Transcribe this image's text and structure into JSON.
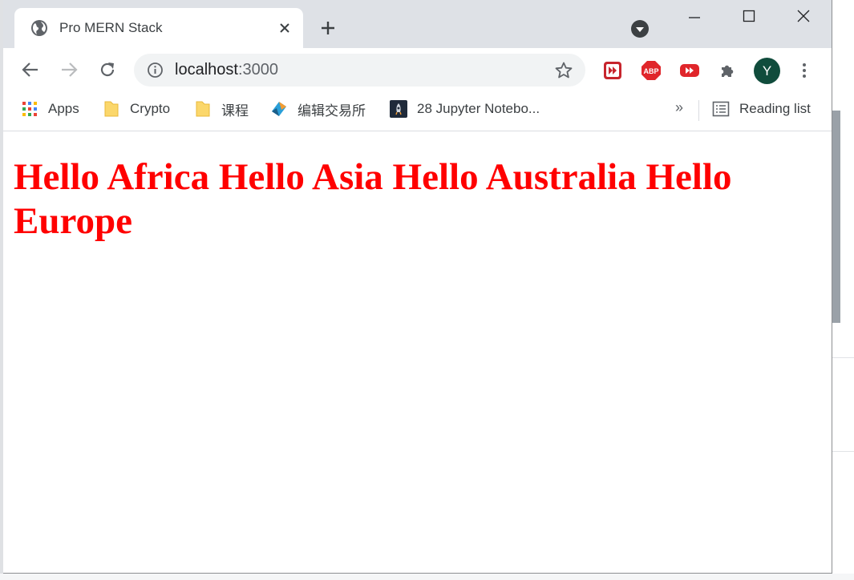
{
  "browser": {
    "tab": {
      "title": "Pro MERN Stack",
      "favicon": "globe-icon"
    },
    "address": {
      "host": "localhost",
      "port": ":3000"
    },
    "avatar_initial": "Y",
    "extensions": [
      "video-speed-controller-icon",
      "adblock-plus-icon",
      "youtube-icon",
      "puzzle-extensions-icon"
    ]
  },
  "bookmarks": {
    "items": [
      {
        "label": "Apps",
        "icon": "apps-grid-icon"
      },
      {
        "label": "Crypto",
        "icon": "folder-icon"
      },
      {
        "label": "课程",
        "icon": "folder-icon"
      },
      {
        "label": "编辑交易所",
        "icon": "site-logo-icon"
      },
      {
        "label": "28 Jupyter Notebo...",
        "icon": "jupyter-icon"
      }
    ],
    "overflow_label": "»",
    "reading_list_label": "Reading list"
  },
  "page": {
    "heading": "Hello Africa Hello Asia Hello Australia Hello Europe",
    "heading_color": "#ff0000"
  },
  "colors": {
    "tabstrip": "#dee1e6",
    "omnibox": "#f1f3f4",
    "avatar": "#104c3c"
  }
}
